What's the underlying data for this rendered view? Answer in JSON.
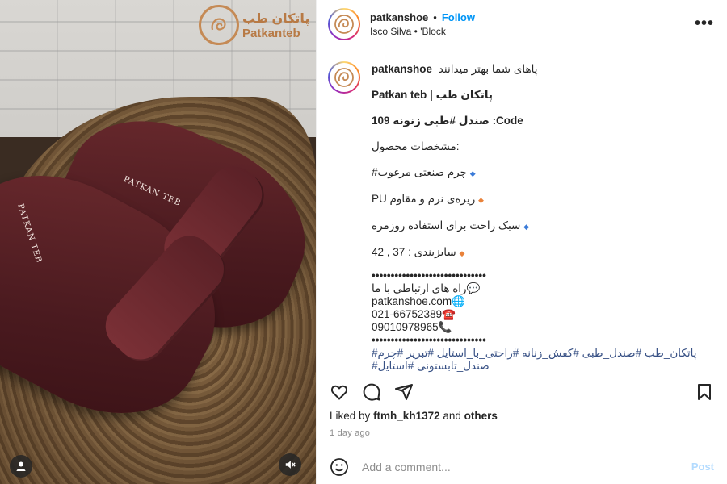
{
  "brand": {
    "name_fa": "پاتکان طب",
    "name_en": "Patkanteb"
  },
  "shoe_print": {
    "left": "PATKAN TEB",
    "right": "PATKAN TEB"
  },
  "header": {
    "username": "patkanshoe",
    "separator": "•",
    "follow_label": "Follow",
    "subtitle": "Isco Silva • 'Block",
    "more": "•••"
  },
  "caption": {
    "username": "patkanshoe",
    "first_line": "پاهای شما بهتر میدانند",
    "brand_line": "Patkan teb | پاتکان طب",
    "code_line": "صندل #طبی زنونه 109 :Code",
    "specs_title": "مشخصات محصول:",
    "bullets": [
      "#چرم صنعتی مرغوب",
      "PU زیره‌ی نرم و مقاوم",
      "سبک راحت برای استفاده روزمره",
      "سایزبندی : 37 , 42"
    ],
    "dots": "••••••••••••••••••••••••••••••",
    "contact_title": "راه های ارتباطی با ما💬",
    "website": "patkanshoe.com🌐",
    "phone": "021-66752389☎️",
    "mobile": "09010978965📞",
    "dots2": "••••••••••••••••••••••••••••••",
    "hashtags1": "#پاتکان_طب #صندل_طبی #کفش_زنانه #راحتی_با_استایل #تبریز #چرم",
    "hashtags2": "#صندل_تابستونی #استایل"
  },
  "likes": {
    "prefix": "Liked by",
    "user": "ftmh_kh1372",
    "and": "and",
    "others": "others"
  },
  "time": "1 day ago",
  "comment": {
    "placeholder": "Add a comment...",
    "post_label": "Post"
  },
  "colors": {
    "link": "#0095f6",
    "brand": "#c58a55",
    "hashtag": "#385185"
  }
}
